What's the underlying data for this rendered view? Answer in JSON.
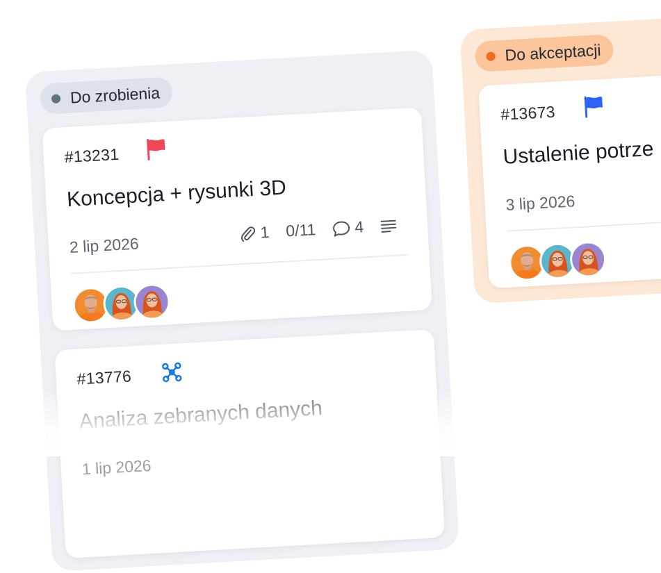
{
  "columns": [
    {
      "name": "Do zrobienia",
      "dot_color": "#607282",
      "cards": [
        {
          "id": "#13231",
          "flag_color": "#f2475b",
          "title": "Koncepcja + rysunki 3D",
          "date": "2 lip 2026",
          "attachments": "1",
          "checklist": "0/11",
          "comments": "4",
          "icons": [
            "paperclip-icon",
            "comment-icon",
            "description-icon"
          ],
          "assignees": [
            "avatar-man",
            "avatar-woman-blue",
            "avatar-woman-purple"
          ]
        },
        {
          "id": "#13776",
          "icon": "subtask-network-icon",
          "icon_color": "#1f7ad6",
          "title": "Analiza zebranych danych",
          "date": "1 lip 2026"
        }
      ]
    },
    {
      "name": "Do akceptacji",
      "dot_color": "#f06b1f",
      "cards": [
        {
          "id": "#13673",
          "flag_color": "#2f63f5",
          "title": "Ustalenie potrze",
          "date": "3 lip 2026",
          "assignees": [
            "avatar-man",
            "avatar-woman-blue",
            "avatar-woman-purple"
          ]
        }
      ]
    }
  ]
}
